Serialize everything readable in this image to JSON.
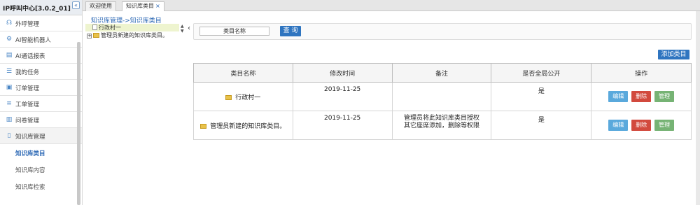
{
  "sidebar": {
    "title": "IP呼叫中心[3.0.2_01]",
    "collapse_glyph": "«",
    "items": [
      {
        "label": "外呼管理",
        "icon": "headset-icon"
      },
      {
        "label": "AI智能机器人",
        "icon": "robot-icon"
      },
      {
        "label": "AI通话报表",
        "icon": "report-icon"
      },
      {
        "label": "我的任务",
        "icon": "task-icon"
      },
      {
        "label": "订单管理",
        "icon": "cart-icon"
      },
      {
        "label": "工单管理",
        "icon": "list-icon"
      },
      {
        "label": "问卷管理",
        "icon": "clipboard-icon"
      },
      {
        "label": "知识库管理",
        "icon": "book-icon"
      }
    ],
    "subitems": [
      {
        "label": "知识库类目"
      },
      {
        "label": "知识库内容"
      },
      {
        "label": "知识库检索"
      }
    ]
  },
  "tabs": [
    {
      "label": "欢迎使用"
    },
    {
      "label": "知识库类目",
      "close": "×"
    }
  ],
  "breadcrumb": "知识库管理->知识库类目",
  "tree": {
    "items": [
      {
        "label": "行政村一"
      },
      {
        "label": "管理员新建的知识库类目。",
        "expander": "+"
      }
    ],
    "scroll_up": "▲",
    "scroll_down": "▼",
    "collapse_glyph": "‹"
  },
  "search": {
    "input_value": "类目名称",
    "button_label": "查 询"
  },
  "add_button_label": "添加类目",
  "table": {
    "headers": [
      "类目名称",
      "修改时间",
      "备注",
      "是否全局公开",
      "操作"
    ],
    "rows": [
      {
        "name": "行政村一",
        "time": "2019-11-25",
        "note": "",
        "public": "是"
      },
      {
        "name": "管理员新建的知识库类目。",
        "time": "2019-11-25",
        "note": "管理员将此知识库类目授权其它座席添加，删除等权限",
        "public": "是"
      }
    ],
    "ops": {
      "edit": "编辑",
      "delete": "删除",
      "manage": "管理"
    }
  }
}
